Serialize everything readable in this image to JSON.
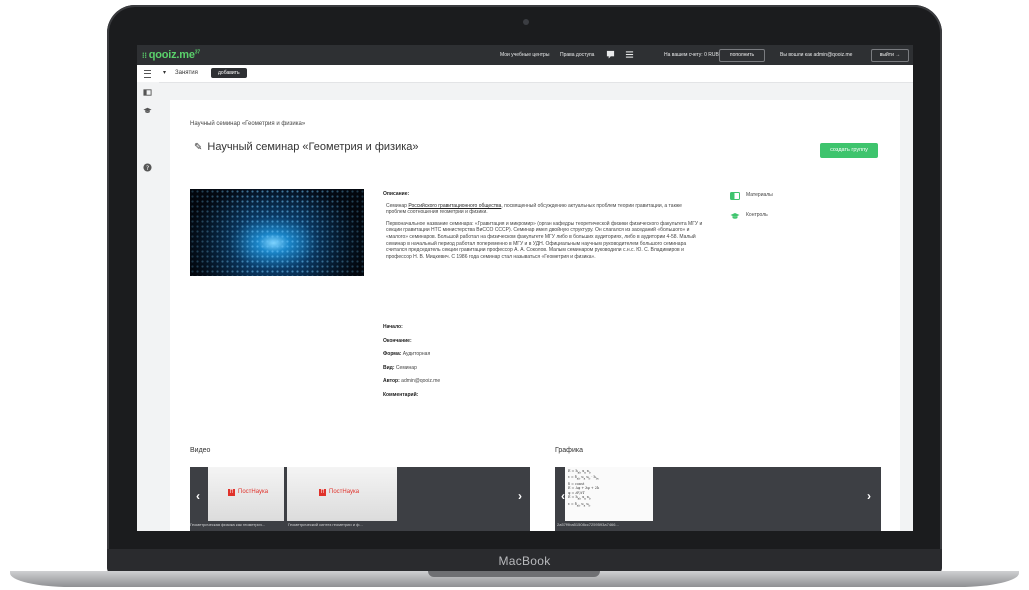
{
  "device": {
    "label": "MacBook"
  },
  "topbar": {
    "logo": "qooiz.me",
    "logo_sup": "37",
    "learning_centers": "Мои учебные центры",
    "access_rights": "Права доступа",
    "balance": "На вашем счету: 0 RUB",
    "top_up": "пополнить",
    "logged_in_as": "Вы вошли как admin@qooiz.me",
    "logout": "выйти"
  },
  "subbar": {
    "lessons": "Занятия",
    "add": "добавить"
  },
  "page": {
    "breadcrumb": "Научный семинар «Геометрия и физика»",
    "title": "Научный семинар «Геометрия и физика»",
    "create_group": "создать группу",
    "description_label": "Описание:",
    "desc_p1_before": "Семинар ",
    "desc_p1_link": "Российского гравитационного общества",
    "desc_p1_after": ", посвященный обсуждению актуальных проблем теории гравитации, а также проблем соотношения геометрии и физики.",
    "desc_p2": "Первоначальное название семинара: «Гравитация и микромир» (орган кафедры теоретической физики физического факультета МГУ и секции гравитации НТС министерства ВиССО СССР). Семинар имел двойную структуру. Он слагался из заседаний «большого» и «малого» семинаров. Большой работал на физическом факультете МГУ либо в больших аудиториях, либо в аудитории 4-58. Малый семинар в начальный период работал попеременно в МГУ и в УДН. Официальным научным руководителем большого семинара считался председатель секции гравитации профессор А. А. Соколов. Малым семинаром руководили с.н.с. Ю. С. Владимиров и профессор Н. В. Мицкевич. С 1986 года семинар стал называться «Геометрия и физика».",
    "meta": {
      "start_label": "Начало:",
      "start_value": "",
      "end_label": "Окончание:",
      "end_value": "",
      "form_label": "Форма:",
      "form_value": "Аудиторная",
      "type_label": "Вид:",
      "type_value": "Семинар",
      "author_label": "Автор:",
      "author_value": "admin@qooiz.me",
      "comment_label": "Комментарий:",
      "comment_value": ""
    },
    "side_links": {
      "materials": "Материалы",
      "control": "Контроль"
    },
    "video_section": "Видео",
    "graphics_section": "Графика",
    "videos": [
      {
        "brand": "ПостНаука",
        "caption": "Геометрическая физика как геометрич..."
      },
      {
        "brand": "ПостНаука",
        "caption": "Геометрический синтез геометрии и ф..."
      }
    ],
    "graphics_caption": "2a57f9ba51508cc7259593a7466..."
  },
  "colors": {
    "accent_green": "#3ec46d",
    "topbar": "#2e3033",
    "brand_red": "#e0322b"
  },
  "icons": {
    "menu": "hamburger-icon",
    "chat": "chat-icon",
    "pen": "pencil-icon",
    "materials": "toggle-icon",
    "control": "graduation-cap-icon"
  }
}
